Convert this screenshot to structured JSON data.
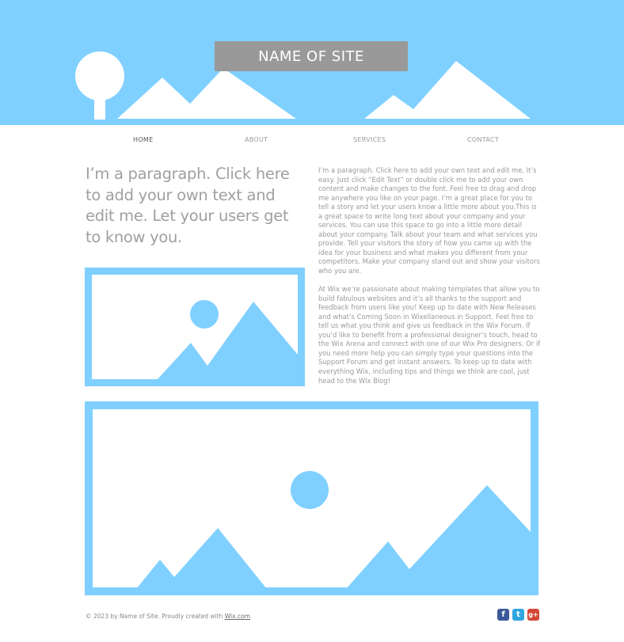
{
  "header": {
    "site_title": "NAME OF SITE",
    "colors": {
      "banner": "#7fd0ff",
      "title_box": "#999999"
    }
  },
  "nav": {
    "items": [
      {
        "label": "HOME",
        "active": true
      },
      {
        "label": "ABOUT",
        "active": false
      },
      {
        "label": "SERVICES",
        "active": false
      },
      {
        "label": "CONTACT",
        "active": false
      }
    ]
  },
  "main": {
    "intro_heading": "I’m a paragraph. Click here to add your own text and edit me. Let your users get to know you.",
    "body_paragraph_1": "I’m a paragraph. Click here to add your own text and edit me. It’s easy. Just click “Edit Text” or double click me to add your own content and make changes to the font. Feel free to drag and drop me anywhere you like on your page. I’m a great place for you to tell a story and let your users know a little more about you.This is a great space to write long text about your company and your services. You can use this space to go into a little more detail about your company. Talk about your team and what services you provide. Tell your visitors the story of how you came up with the idea for your business and what makes you different from your competitors. Make your company stand out and show your visitors who you are.",
    "body_paragraph_2": "At Wix we’re passionate about making templates that allow you to build fabulous websites and it’s all thanks to the support and feedback from users like you! Keep up to date with New Releases and what’s Coming Soon in Wixellaneous in Support. Feel free to tell us what you think and give us feedback in the Wix Forum. If you’d like to benefit from a professional designer’s touch, head to the Wix Arena and connect with one of our Wix Pro designers. Or if you need more help you can simply type your questions into the Support Forum and get instant answers. To keep up to date with everything Wix, including tips and things we think are cool, just head to the Wix Blog!",
    "placeholder_color": "#7fd0ff"
  },
  "footer": {
    "copyright": "© 2023 by Name of Site. Proudly created with ",
    "link_text": "Wix.com",
    "social": [
      {
        "icon": "facebook-icon",
        "glyph": "f",
        "color": "#3b5998"
      },
      {
        "icon": "twitter-icon",
        "glyph": "t",
        "color": "#2fa6e0"
      },
      {
        "icon": "google-plus-icon",
        "glyph": "g+",
        "color": "#d34836"
      }
    ]
  }
}
